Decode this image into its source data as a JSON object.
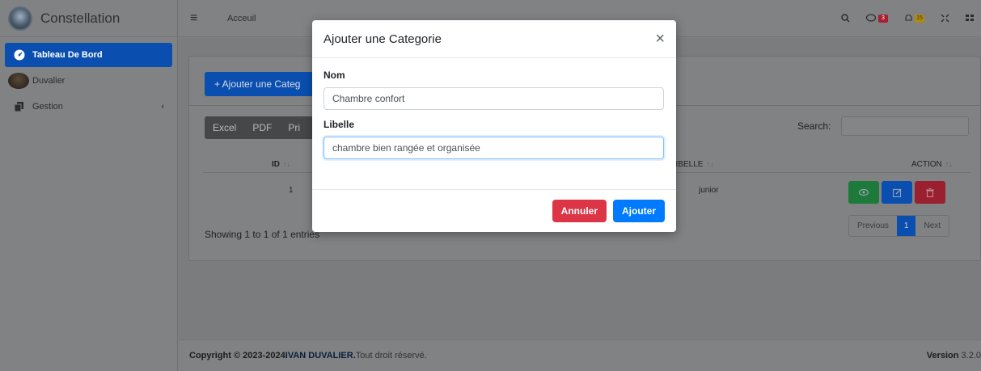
{
  "brand": {
    "name": "Constellation"
  },
  "sidebar": {
    "items": [
      {
        "label": "Tableau De Bord",
        "icon": "dashboard-icon",
        "active": true
      },
      {
        "label": "Duvalier",
        "icon": "user-avatar"
      },
      {
        "label": "Gestion",
        "icon": "copy-icon",
        "chevron": "‹"
      }
    ]
  },
  "topbar": {
    "breadcrumb": "Acceuil",
    "message_badge": "3",
    "notification_badge": "15"
  },
  "card": {
    "add_button": "+ Ajouter une Categ",
    "export_buttons": [
      "Excel",
      "PDF",
      "Pri"
    ],
    "search_label": "Search:",
    "columns": {
      "id": "ID",
      "libelle": "LIBELLE",
      "action": "ACTION"
    },
    "rows": [
      {
        "id": "1",
        "libelle": "junior"
      }
    ],
    "showing": "Showing 1 to 1 of 1 entries",
    "pagination": {
      "previous": "Previous",
      "current": "1",
      "next": "Next"
    }
  },
  "footer": {
    "copyright_prefix": "Copyright © 2023-2024 ",
    "author": "IVAN DUVALIER.",
    "rights": " Tout droit réservé.",
    "version_label": "Version",
    "version_value": " 3.2.0"
  },
  "modal": {
    "title": "Ajouter une Categorie",
    "close": "×",
    "nom_label": "Nom",
    "nom_value": "Chambre confort",
    "libelle_label": "Libelle",
    "libelle_value": "chambre bien rangée et organisée",
    "cancel_label": "Annuler",
    "submit_label": "Ajouter"
  },
  "colors": {
    "primary": "#007bff",
    "danger": "#dc3545",
    "success": "#28a745",
    "sidebar_active": "#0a4fb0"
  }
}
